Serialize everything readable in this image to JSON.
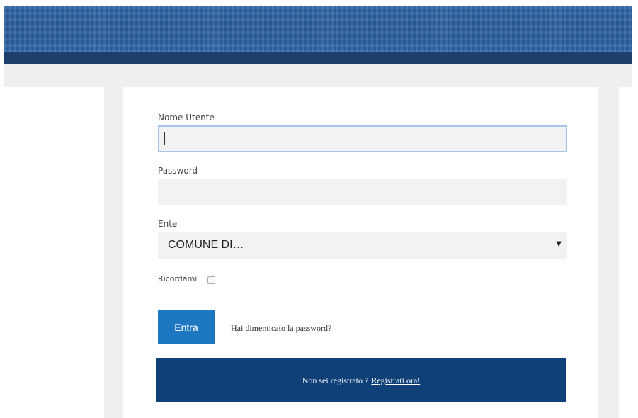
{
  "colors": {
    "banner": "#2f66a8",
    "band": "#1c3f6b",
    "primary_button": "#1d78c1",
    "register_bar": "#0f4077",
    "field_bg": "#f2f2f2",
    "focus_border": "#a9c4ec"
  },
  "form": {
    "username_label": "Nome Utente",
    "username_value": "",
    "password_label": "Password",
    "password_value": "",
    "ente_label": "Ente",
    "ente_selected": "COMUNE DI…",
    "remember_label": "Ricordami",
    "remember_checked": false,
    "submit_label": "Entra",
    "forgot_link": "Hai dimenticato la password?"
  },
  "register": {
    "prompt": "Non sei registrato ?",
    "link": "Registrati ora!"
  },
  "icons": {
    "select_arrow": "caret-down-icon"
  }
}
